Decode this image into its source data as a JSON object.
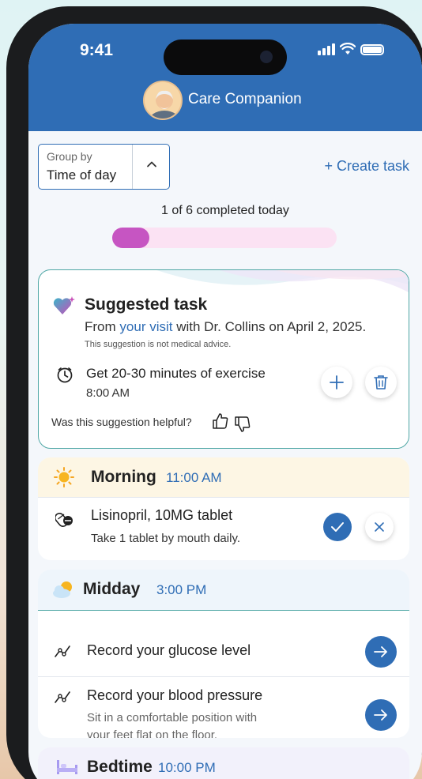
{
  "status_bar": {
    "time": "9:41"
  },
  "header": {
    "title": "Care Companion"
  },
  "controls": {
    "group_by_label": "Group by",
    "group_by_value": "Time of day",
    "create_task": "+ Create task"
  },
  "progress": {
    "text": "1 of 6 completed today",
    "completed": 1,
    "total": 6
  },
  "suggested": {
    "title": "Suggested task",
    "from_prefix": "From",
    "from_link": "your visit",
    "from_suffix": "with Dr. Collins on April 2, 2025.",
    "disclaimer": "This suggestion is not medical advice.",
    "task": "Get 20-30 minutes of exercise",
    "time": "8:00 AM",
    "helpful_prompt": "Was this suggestion helpful?"
  },
  "sections": {
    "morning": {
      "title": "Morning",
      "time": "11:00 AM",
      "items": [
        {
          "title": "Lisinopril, 10MG tablet",
          "subtitle": "Take 1 tablet by mouth daily."
        }
      ]
    },
    "midday": {
      "title": "Midday",
      "time": "3:00 PM",
      "items": [
        {
          "title": "Record your glucose level"
        },
        {
          "title": "Record your blood pressure",
          "subtitle_line1": "Sit in a comfortable position with",
          "subtitle_line2": "your feet flat on the floor."
        }
      ]
    },
    "bedtime": {
      "title": "Bedtime",
      "time": "10:00 PM"
    }
  },
  "colors": {
    "primary": "#2f6db5",
    "progress_fill": "#c655c2",
    "progress_track": "#fbe2f3",
    "suggested_border": "#4fa7a5"
  },
  "icons": {
    "heart": "heart-sparkle-icon",
    "clock": "clock-icon",
    "add": "plus-icon",
    "trash": "trash-icon",
    "thumbs_up": "thumbs-up-icon",
    "thumbs_down": "thumbs-down-icon",
    "sun": "sun-icon",
    "pill": "pill-icon",
    "cloud": "partly-cloudy-icon",
    "chart": "trend-icon",
    "arrow": "arrow-right-icon",
    "bed": "bed-icon"
  }
}
